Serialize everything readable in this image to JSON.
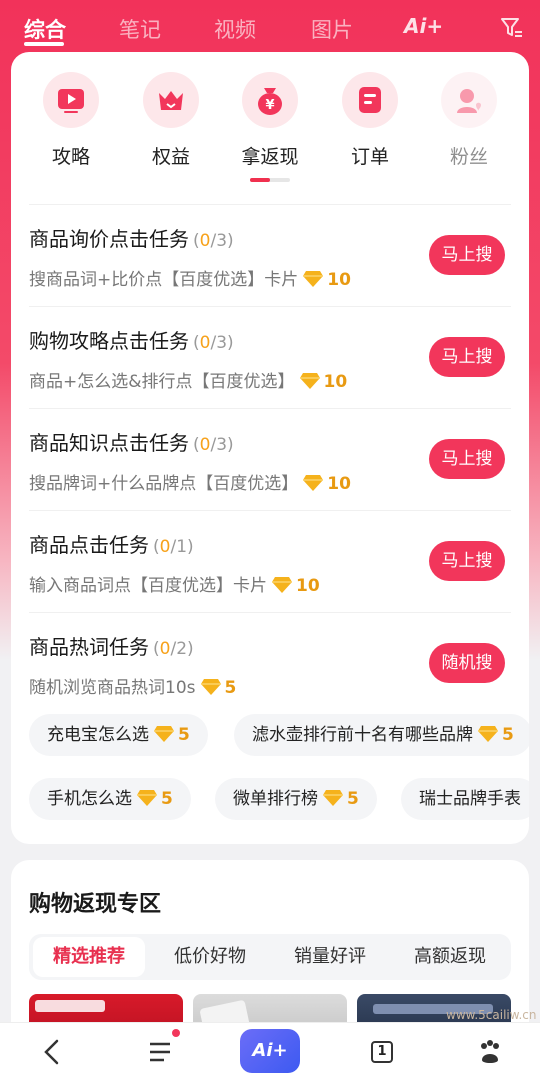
{
  "tabs": [
    "综合",
    "笔记",
    "视频",
    "图片"
  ],
  "ai_tab": "Ai+",
  "categories": [
    {
      "label": "攻略",
      "icon": "play-video-icon"
    },
    {
      "label": "权益",
      "icon": "crown-icon"
    },
    {
      "label": "拿返现",
      "icon": "money-bag-icon"
    },
    {
      "label": "订单",
      "icon": "order-icon"
    },
    {
      "label": "粉丝",
      "icon": "fans-icon"
    }
  ],
  "tasks": [
    {
      "title": "商品询价点击任务",
      "prog_open": "(",
      "prog_cur": "0",
      "prog_rest": "/3)",
      "desc": "搜商品词+比价点【百度优选】卡片",
      "points": "10",
      "button": "马上搜"
    },
    {
      "title": "购物攻略点击任务",
      "prog_open": "(",
      "prog_cur": "0",
      "prog_rest": "/3)",
      "desc": "商品+怎么选&排行点【百度优选】",
      "points": "10",
      "button": "马上搜"
    },
    {
      "title": "商品知识点击任务",
      "prog_open": "(",
      "prog_cur": "0",
      "prog_rest": "/3)",
      "desc": "搜品牌词+什么品牌点【百度优选】",
      "points": "10",
      "button": "马上搜"
    },
    {
      "title": "商品点击任务",
      "prog_open": "(",
      "prog_cur": "0",
      "prog_rest": "/1)",
      "desc": "输入商品词点【百度优选】卡片",
      "points": "10",
      "button": "马上搜"
    },
    {
      "title": "商品热词任务",
      "prog_open": "(",
      "prog_cur": "0",
      "prog_rest": "/2)",
      "desc": "随机浏览商品热词10s",
      "points": "5",
      "button": "随机搜"
    }
  ],
  "chips_row1": [
    {
      "label": "充电宝怎么选",
      "points": "5"
    },
    {
      "label": "滤水壶排行前十名有哪些品牌",
      "points": "5"
    }
  ],
  "chips_row2": [
    {
      "label": "手机怎么选",
      "points": "5"
    },
    {
      "label": "微单排行榜",
      "points": "5"
    },
    {
      "label": "瑞士品牌手表",
      "points": ""
    }
  ],
  "cashback": {
    "title": "购物返现专区",
    "segments": [
      "精选推荐",
      "低价好物",
      "销量好评",
      "高额返现"
    ]
  },
  "bottom": {
    "ai_label": "Ai+",
    "tab_count": "1"
  },
  "watermark": "www.5cailiw.cn",
  "colors": {
    "accent": "#f2365b",
    "points": "#e89a12",
    "progress": "#f7a21b"
  }
}
